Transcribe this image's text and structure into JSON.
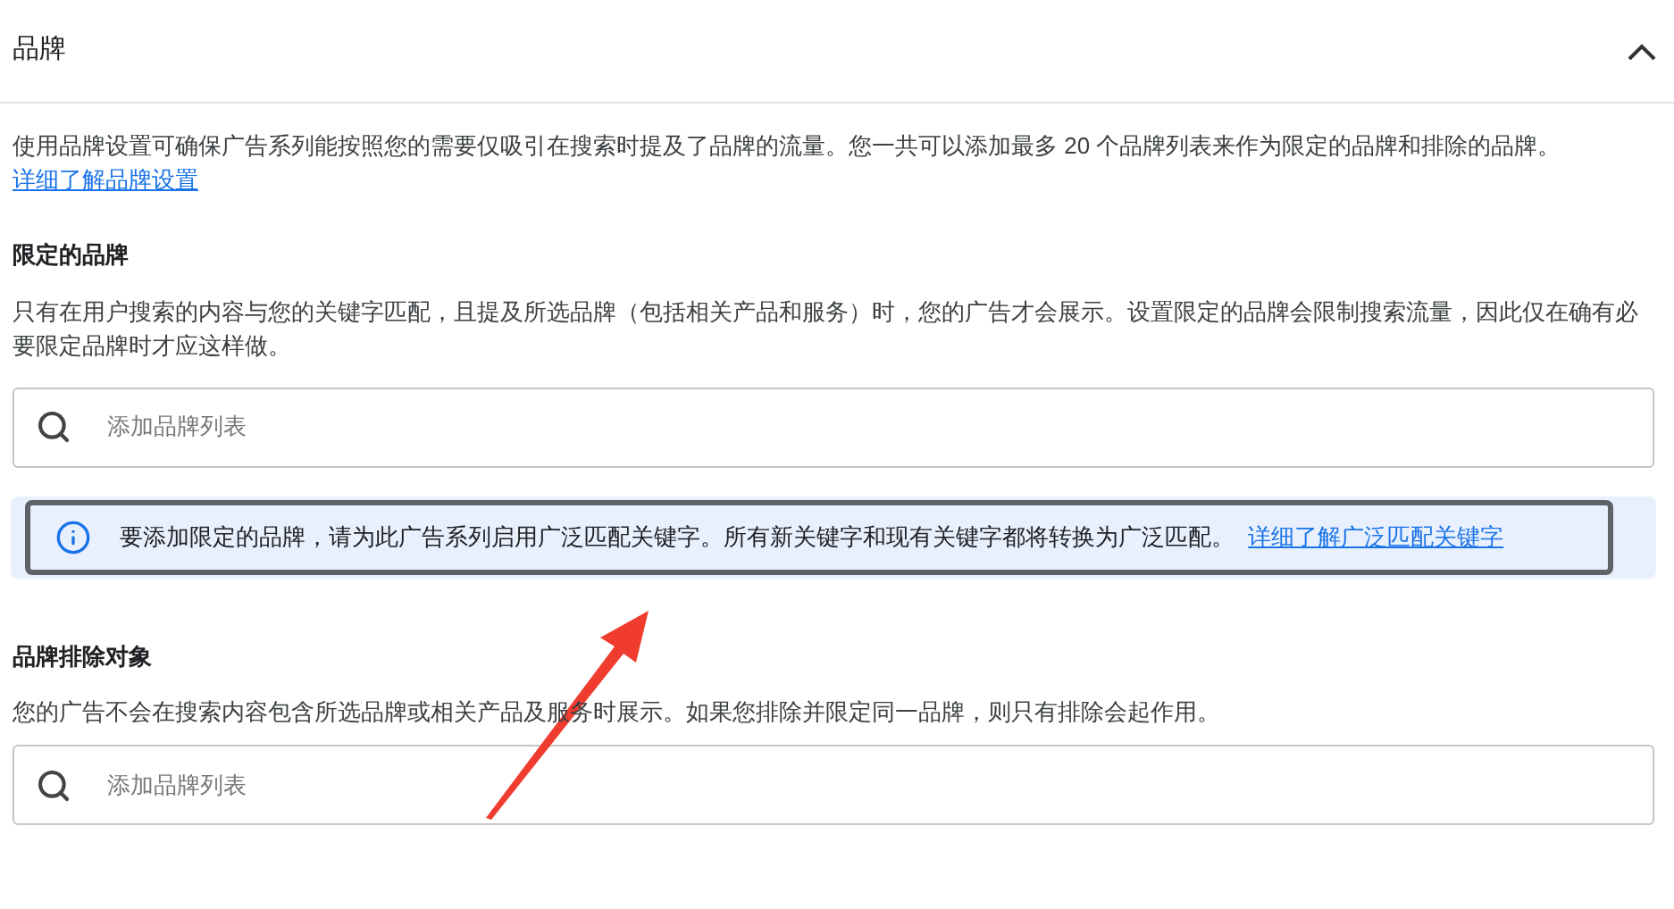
{
  "section": {
    "title": "品牌",
    "expanded": true
  },
  "intro": {
    "text": "使用品牌设置可确保广告系列能按照您的需要仅吸引在搜索时提及了品牌的流量。您一共可以添加最多 20 个品牌列表来作为限定的品牌和排除的品牌。",
    "link": "详细了解品牌设置"
  },
  "limited_brands": {
    "heading": "限定的品牌",
    "description": "只有在用户搜索的内容与您的关键字匹配，且提及所选品牌（包括相关产品和服务）时，您的广告才会展示。设置限定的品牌会限制搜索流量，因此仅在确有必要限定品牌时才应这样做。",
    "search": {
      "placeholder": "添加品牌列表"
    }
  },
  "info_banner": {
    "text": "要添加限定的品牌，请为此广告系列启用广泛匹配关键字。所有新关键字和现有关键字都将转换为广泛匹配。",
    "link": "详细了解广泛匹配关键字",
    "highlighted": true
  },
  "brand_exclusions": {
    "heading": "品牌排除对象",
    "description": "您的广告不会在搜索内容包含所选品牌或相关产品及服务时展示。如果您排除并限定同一品牌，则只有排除会起作用。",
    "search": {
      "placeholder": "添加品牌列表"
    }
  }
}
